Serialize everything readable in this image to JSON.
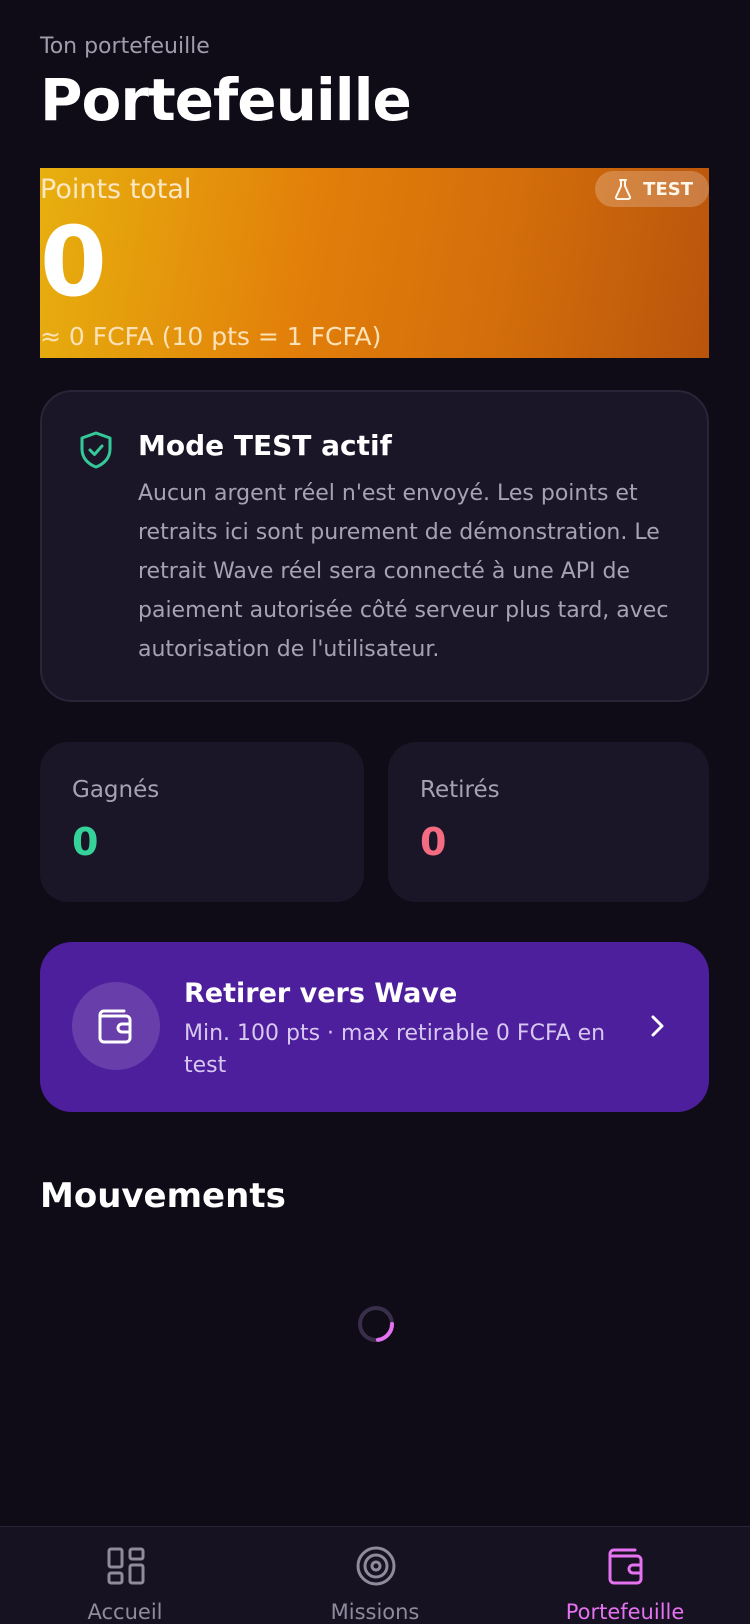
{
  "header": {
    "eyebrow": "Ton portefeuille",
    "title": "Portefeuille"
  },
  "points_card": {
    "label": "Points total",
    "value": "0",
    "conversion": "≈ 0 FCFA (10 pts = 1 FCFA)",
    "badge": "TEST",
    "badge_icon": "flask-icon"
  },
  "test_notice": {
    "icon": "shield-check-icon",
    "title": "Mode TEST actif",
    "text": "Aucun argent réel n'est envoyé. Les points et retraits ici sont purement de démonstration. Le retrait Wave réel sera connecté à une API de paiement autorisée côté serveur plus tard, avec autorisation de l'utilisateur."
  },
  "stats": {
    "earned_label": "Gagnés",
    "earned_value": "0",
    "withdrawn_label": "Retirés",
    "withdrawn_value": "0"
  },
  "withdraw": {
    "icon": "wallet-icon",
    "title": "Retirer vers Wave",
    "subtitle": "Min. 100 pts · max retirable 0 FCFA en test"
  },
  "movements": {
    "title": "Mouvements"
  },
  "tabbar": {
    "items": [
      {
        "label": "Accueil",
        "icon": "grid-icon"
      },
      {
        "label": "Missions",
        "icon": "target-icon"
      },
      {
        "label": "Portefeuille",
        "icon": "wallet-icon"
      }
    ],
    "active_index": 2
  },
  "colors": {
    "background": "#0f0c18",
    "card": "#1b1627",
    "earned": "#35d39a",
    "withdrawn": "#f46b82",
    "withdraw_card": "#4e1f9c",
    "accent": "#e572f0",
    "shield": "#35c99a"
  }
}
